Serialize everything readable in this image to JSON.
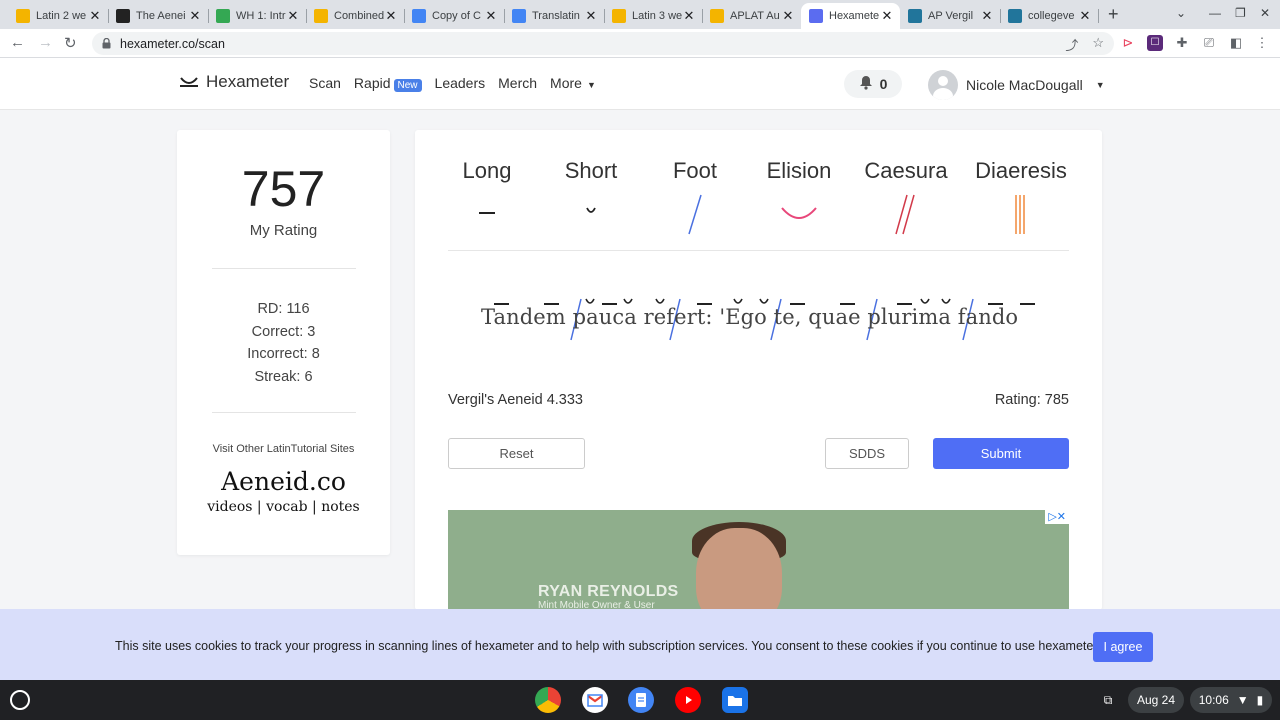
{
  "tabs": [
    {
      "title": "Latin 2 we",
      "fav": "#f4b400"
    },
    {
      "title": "The Aenei",
      "fav": "#222222"
    },
    {
      "title": "WH 1: Intr",
      "fav": "#34a853"
    },
    {
      "title": "Combined",
      "fav": "#f4b400"
    },
    {
      "title": "Copy of C",
      "fav": "#4285f4"
    },
    {
      "title": "Translatin",
      "fav": "#4285f4"
    },
    {
      "title": "Latin 3 we",
      "fav": "#f4b400"
    },
    {
      "title": "APLAT Au",
      "fav": "#f4b400"
    },
    {
      "title": "Hexamete",
      "fav": "#5b6cf0"
    },
    {
      "title": "AP Vergil",
      "fav": "#21759b"
    },
    {
      "title": "collegeve",
      "fav": "#21759b"
    }
  ],
  "browser": {
    "url": "hexameter.co/scan"
  },
  "site": {
    "brand": "Hexameter",
    "nav": {
      "scan": "Scan",
      "rapid": "Rapid",
      "new_badge": "New",
      "leaders": "Leaders",
      "merch": "Merch",
      "more": "More"
    },
    "notifications": "0",
    "user_name": "Nicole MacDougall"
  },
  "sidebar": {
    "rating": "757",
    "rating_label": "My Rating",
    "rd": "RD: 116",
    "correct": "Correct: 3",
    "incorrect": "Incorrect: 8",
    "streak": "Streak: 6",
    "visit": "Visit Other LatinTutorial Sites",
    "aeneid": "Aeneid.co",
    "aeneid_sub": "videos | vocab | notes"
  },
  "legend": {
    "long": "Long",
    "short": "Short",
    "foot": "Foot",
    "elision": "Elision",
    "caesura": "Caesura",
    "diaeresis": "Diaeresis"
  },
  "verse": {
    "text": "Tandem pauca refert: 'Ego te, quae plurima fando"
  },
  "line_info": {
    "reference": "Vergil's Aeneid 4.333",
    "rating": "Rating: 785"
  },
  "buttons": {
    "reset": "Reset",
    "sdds": "SDDS",
    "submit": "Submit"
  },
  "ad": {
    "name": "RYAN REYNOLDS",
    "sub": "Mint Mobile Owner & User"
  },
  "cookie": {
    "message": "This site uses cookies to track your progress in scanning lines of hexameter and to help with subscription services. You consent to these cookies if you continue to use hexameter.co.",
    "agree": "I agree"
  },
  "shelf": {
    "date": "Aug 24",
    "time": "10:06"
  },
  "colors": {
    "accent": "#4f6ef5",
    "foot": "#4a70e0",
    "elision": "#e8477a",
    "caesura": "#d23a4a",
    "diaeresis": "#f0883a"
  }
}
